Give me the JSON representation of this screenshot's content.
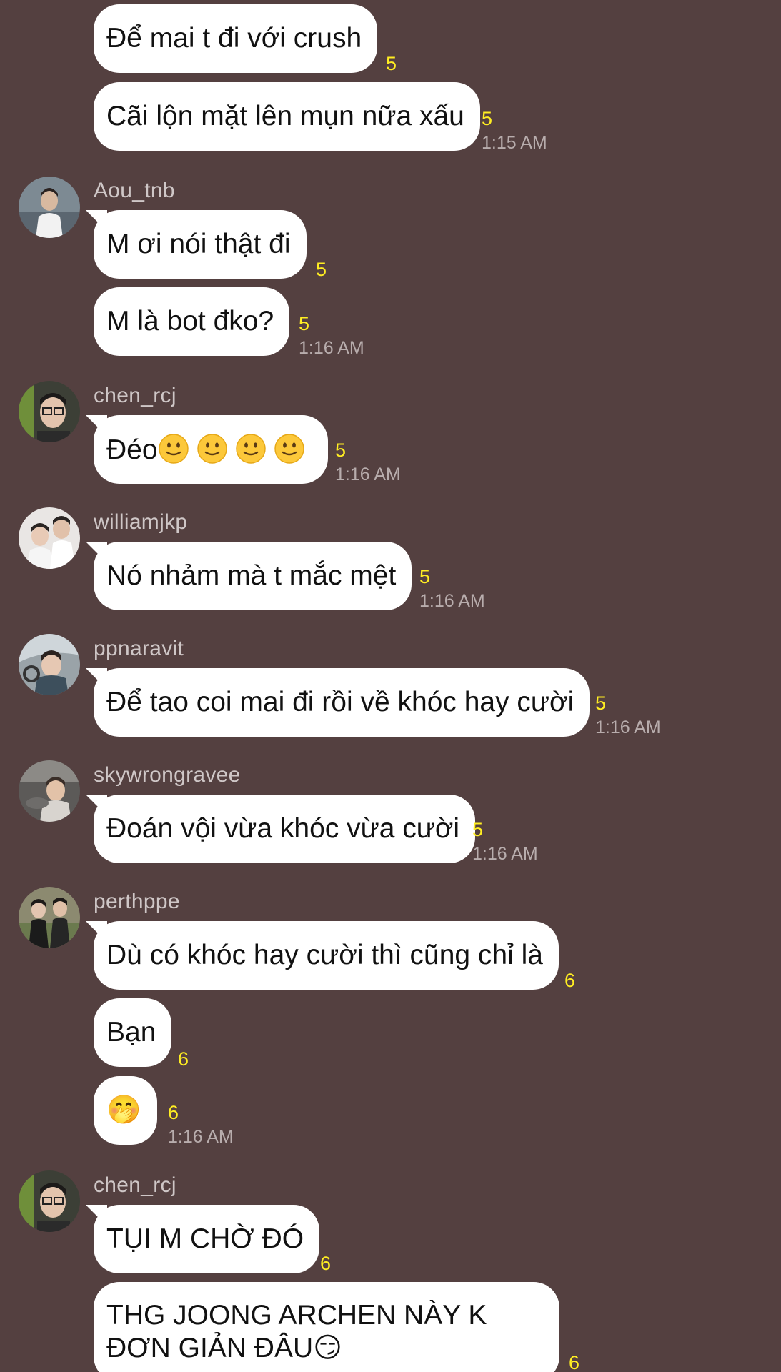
{
  "messages": [
    {
      "text": "Để mai t đi với crush",
      "read": "5"
    },
    {
      "text": "Cãi lộn mặt lên mụn nữa xấu",
      "read": "5",
      "time": "1:15 AM"
    },
    {
      "user": "Aou_tnb",
      "text": "M ơi nói thật đi",
      "read": "5"
    },
    {
      "text": "M là bot đko?",
      "read": "5",
      "time": "1:16 AM"
    },
    {
      "user": "chen_rcj",
      "text": "Đéo",
      "emoji": [
        "slightly-smiling-face",
        "slightly-smiling-face",
        "slightly-smiling-face",
        "slightly-smiling-face"
      ],
      "read": "5",
      "time": "1:16 AM"
    },
    {
      "user": "williamjkp",
      "text": "Nó nhảm mà t mắc mệt",
      "read": "5",
      "time": "1:16 AM"
    },
    {
      "user": "ppnaravit",
      "text": "Để tao coi mai đi rồi về khóc hay cười",
      "read": "5",
      "time": "1:16 AM"
    },
    {
      "user": "skywrongravee",
      "text": "Đoán vội vừa khóc vừa cười",
      "read": "5",
      "time": "1:16 AM"
    },
    {
      "user": "perthppe",
      "text": "Dù có khóc hay cười thì cũng chỉ là",
      "read": "6"
    },
    {
      "text": "Bạn",
      "read": "6"
    },
    {
      "text": "🤭",
      "read": "6",
      "time": "1:16 AM"
    },
    {
      "user": "chen_rcj",
      "text": "TỤI M CHỜ ĐÓ",
      "read": "6"
    },
    {
      "text": "THG JOONG ARCHEN NÀY K ĐƠN GIẢN ĐÂU😏",
      "read": "6"
    }
  ],
  "colors": {
    "background": "#544040",
    "bubble": "#ffffff",
    "read_count": "#ffee22",
    "meta_text": "#b8adad"
  }
}
